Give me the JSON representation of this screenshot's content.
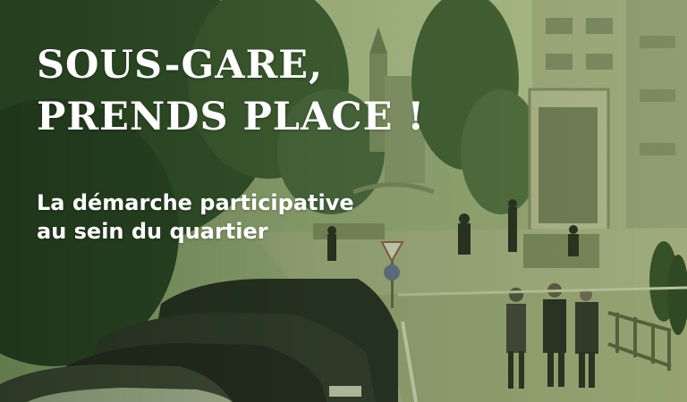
{
  "hero": {
    "title_line1": "SOUS-GARE,",
    "title_line2": "PRENDS PLACE !",
    "subtitle_line1": "La démarche participative",
    "subtitle_line2": "au sein du quartier"
  },
  "colors": {
    "tint": "#5a7a45",
    "text": "#ffffff"
  }
}
